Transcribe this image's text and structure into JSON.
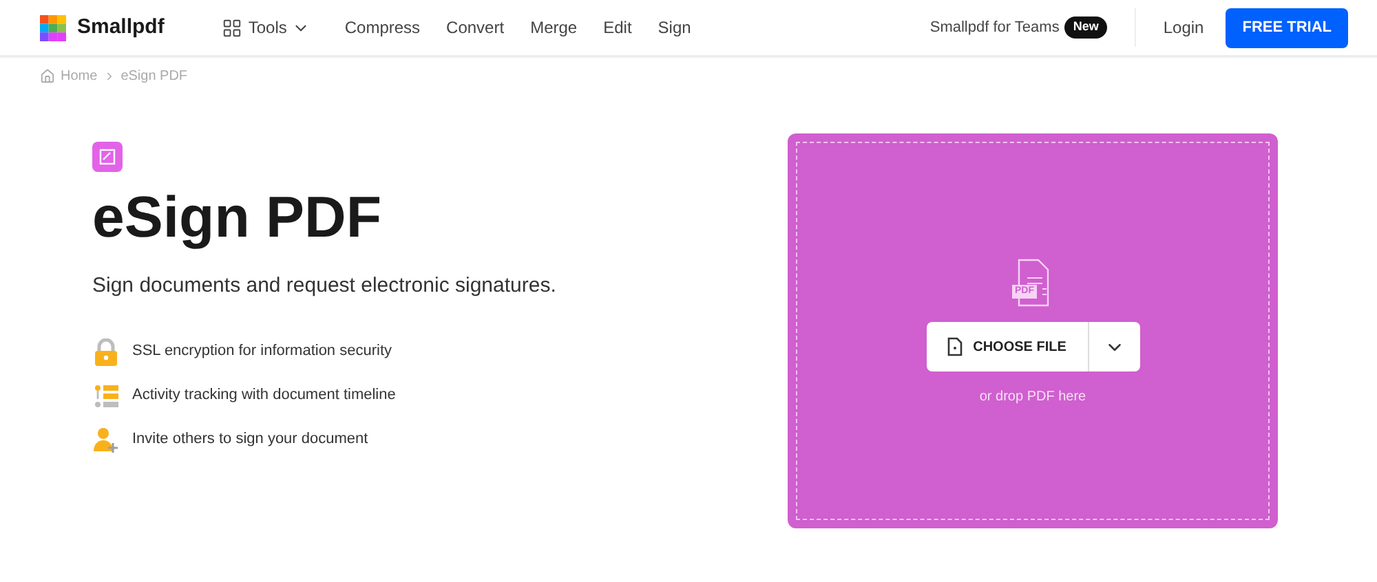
{
  "header": {
    "logo": "Smallpdf",
    "tools": "Tools",
    "nav": [
      "Compress",
      "Convert",
      "Merge",
      "Edit",
      "Sign"
    ],
    "teams": "Smallpdf for Teams",
    "teams_badge": "New",
    "login": "Login",
    "cta": "FREE TRIAL"
  },
  "breadcrumb": [
    "Home",
    "eSign PDF"
  ],
  "hero": {
    "title": "eSign PDF",
    "subtitle": "Sign documents and request electronic signatures.",
    "features": [
      {
        "kind": "lock",
        "text": "SSL encryption for information security"
      },
      {
        "kind": "timeline",
        "text": "Activity tracking with document timeline"
      },
      {
        "kind": "invite",
        "text": "Invite others to sign your document"
      }
    ]
  },
  "dropzone": {
    "file_label": "PDF",
    "button": "CHOOSE FILE",
    "hint": "or drop PDF here"
  }
}
